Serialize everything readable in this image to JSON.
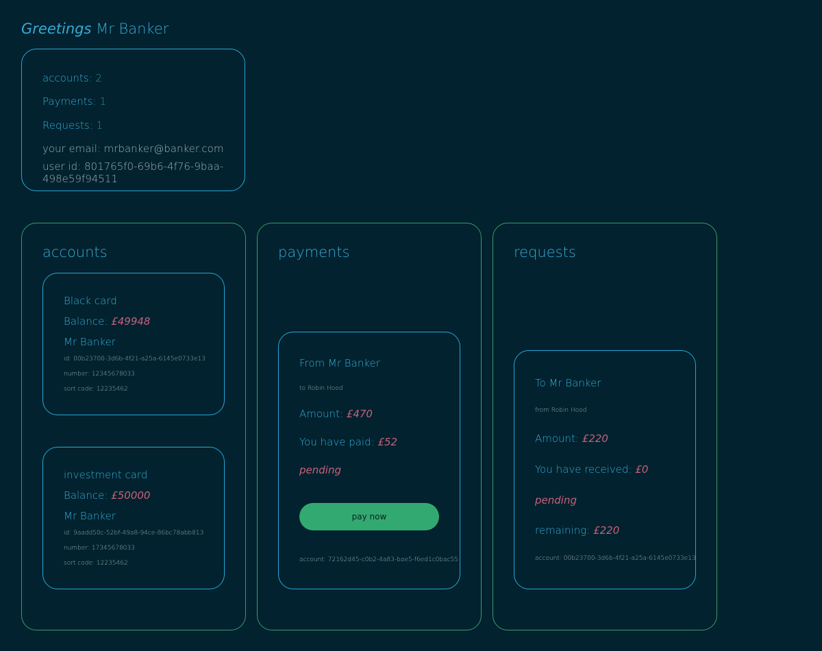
{
  "greeting": {
    "prefix": "Greetings",
    "name": "Mr Banker"
  },
  "summary": {
    "accounts_label": "accounts:",
    "accounts_value": "2",
    "payments_label": "Payments:",
    "payments_value": "1",
    "requests_label": "Requests:",
    "requests_value": "1",
    "email_line": "your email: mrbanker@banker.com",
    "user_id_line": "user id: 801765f0-69b6-4f76-9baa-498e59f94511"
  },
  "accounts": {
    "title": "accounts",
    "cards": [
      {
        "name": "Black card",
        "balance_label": "Balance:",
        "balance_value": "£49948",
        "owner": "Mr Banker",
        "id_line": "id: 00b23700-3d6b-4f21-a25a-6145e0733e13",
        "number_line": "number: 12345678033",
        "sort_line": "sort code: 12235462"
      },
      {
        "name": "investment card",
        "balance_label": "Balance:",
        "balance_value": "£50000",
        "owner": "Mr Banker",
        "id_line": "id: 9aadd50c-52bf-49a8-94ce-86bc78abb813",
        "number_line": "number: 17345678033",
        "sort_line": "sort code: 12235462"
      }
    ]
  },
  "payments": {
    "title": "payments",
    "items": [
      {
        "from_line": "From Mr Banker",
        "to_line": "to Robin Hood",
        "amount_label": "Amount:",
        "amount_value": "£470",
        "paid_label": "You have paid:",
        "paid_value": "£52",
        "status": "pending",
        "button_label": "pay now",
        "account_line": "account: 72162d45-c0b2-4a83-bae5-f6ed1c0bac55"
      }
    ]
  },
  "requests": {
    "title": "requests",
    "items": [
      {
        "to_line": "To Mr Banker",
        "from_line": "from Robin Hood",
        "amount_label": "Amount:",
        "amount_value": "£220",
        "received_label": "You have received:",
        "received_value": "£0",
        "status": "pending",
        "remaining_label": "remaining:",
        "remaining_value": "£220",
        "account_line": "account: 00b23700-3d6b-4f21-a25a-6145e0733e13"
      }
    ]
  },
  "colors": {
    "background": "#01222e",
    "text_blue": "#38a9d6",
    "text_pink": "#c8607c",
    "border_blue": "#2aa7d9",
    "border_green": "#3d9a6a",
    "button_green": "#33a972"
  }
}
